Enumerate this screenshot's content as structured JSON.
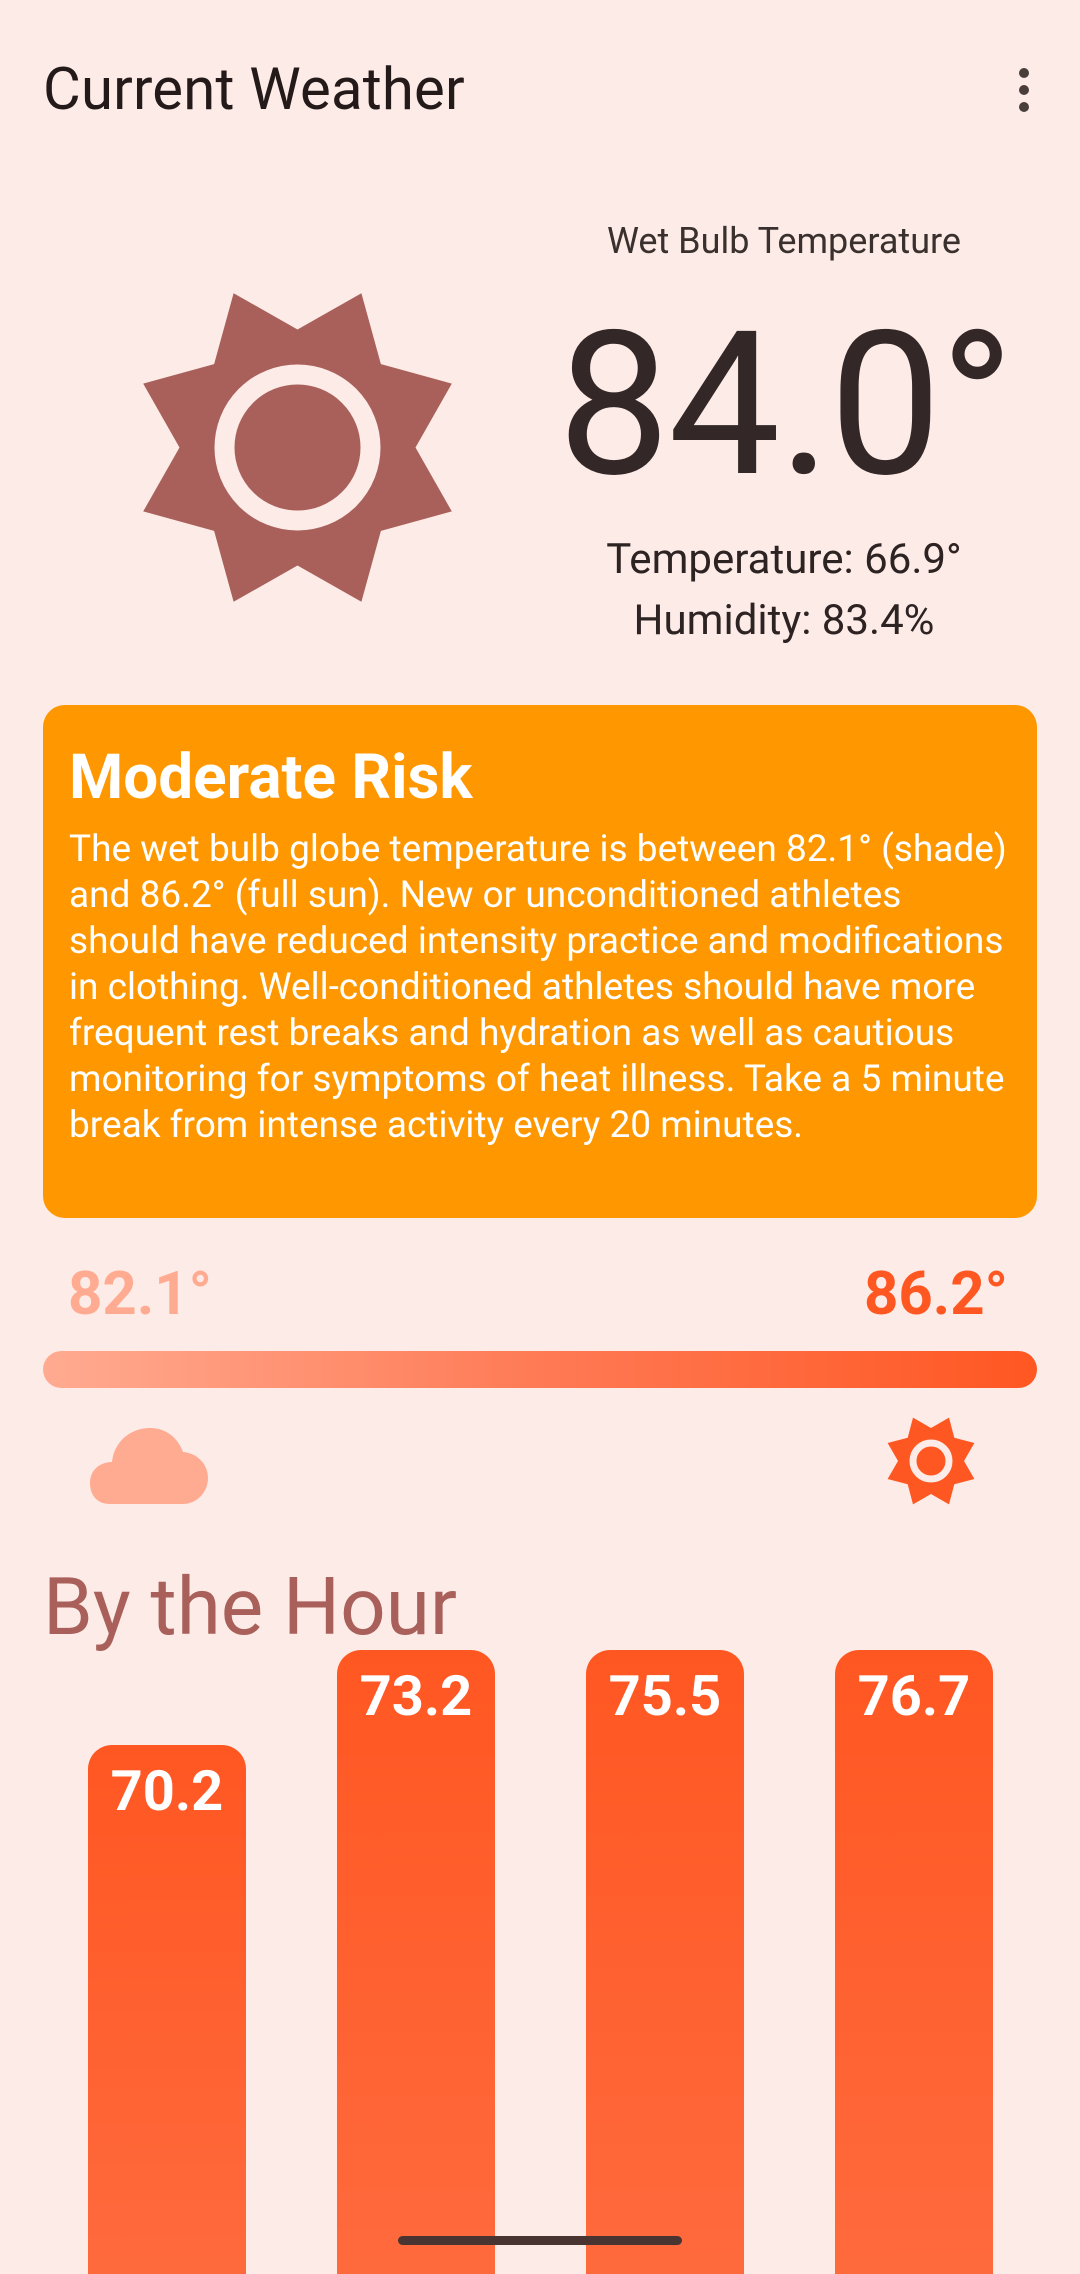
{
  "app": {
    "title": "Current Weather"
  },
  "current": {
    "wet_bulb_label": "Wet Bulb Temperature",
    "wet_bulb_value": "84.0°",
    "temperature_text": "Temperature: 66.9°",
    "humidity_text": "Humidity: 83.4%",
    "condition_icon": "sun-icon"
  },
  "risk": {
    "title": "Moderate Risk",
    "description": "The wet bulb globe temperature is between 82.1° (shade) and 86.2° (full sun). New or unconditioned athletes should have reduced intensity practice and modifications in clothing. Well-conditioned athletes should have more frequent rest breaks and hydration as well as cautious monitoring for symptoms of heat illness. Take a 5 minute break from intense activity every 20 minutes.",
    "color": "#ff9800"
  },
  "range": {
    "low": "82.1°",
    "high": "86.2°",
    "low_color": "#ffab91",
    "high_color": "#ff5722",
    "low_icon": "cloud-icon",
    "high_icon": "sun-icon"
  },
  "hourly": {
    "title": "By the Hour",
    "bar_color": "#ff5722"
  },
  "chart_data": {
    "type": "bar",
    "title": "By the Hour",
    "categories": [
      "",
      "",
      "",
      ""
    ],
    "values": [
      70.2,
      73.2,
      75.5,
      76.7
    ],
    "value_labels": [
      "70.2",
      "73.2",
      "75.5",
      "76.7"
    ],
    "xlabel": "",
    "ylabel": "",
    "grid": false,
    "legend": "none"
  }
}
